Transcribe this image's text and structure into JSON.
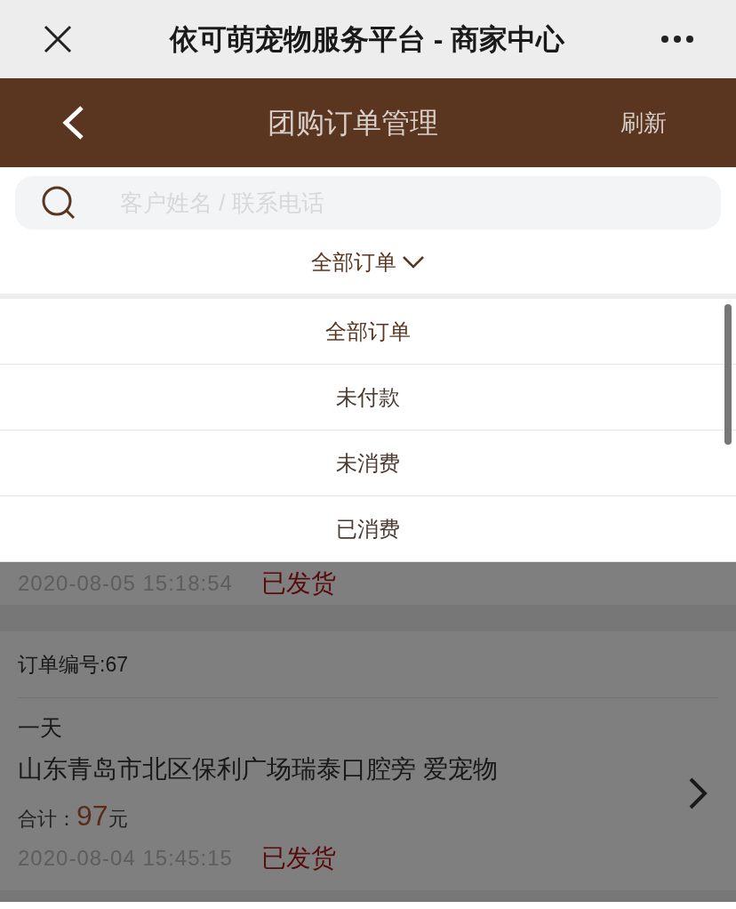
{
  "top_bar": {
    "title": "依可萌宠物服务平台 - 商家中心"
  },
  "header": {
    "title": "团购订单管理",
    "action": "刷新"
  },
  "search": {
    "placeholder": "客户姓名 / 联系电话"
  },
  "filter": {
    "label": "全部订单",
    "expanded": true
  },
  "dropdown": {
    "options": [
      {
        "label": "全部订单",
        "selected": true
      },
      {
        "label": "未付款",
        "selected": false
      },
      {
        "label": "未消费",
        "selected": false
      },
      {
        "label": "已消费",
        "selected": false
      }
    ]
  },
  "orders": [
    {
      "time": "2020-08-05 15:18:54",
      "status": "已发货"
    },
    {
      "order_no": "订单编号:67",
      "name": "一天",
      "address": "山东青岛市北区保利广场瑞泰口腔旁 爱宠物",
      "total_label": "合计：",
      "amount": "97",
      "unit": "元",
      "time": "2020-08-04 15:45:15",
      "status": "已发货"
    }
  ]
}
